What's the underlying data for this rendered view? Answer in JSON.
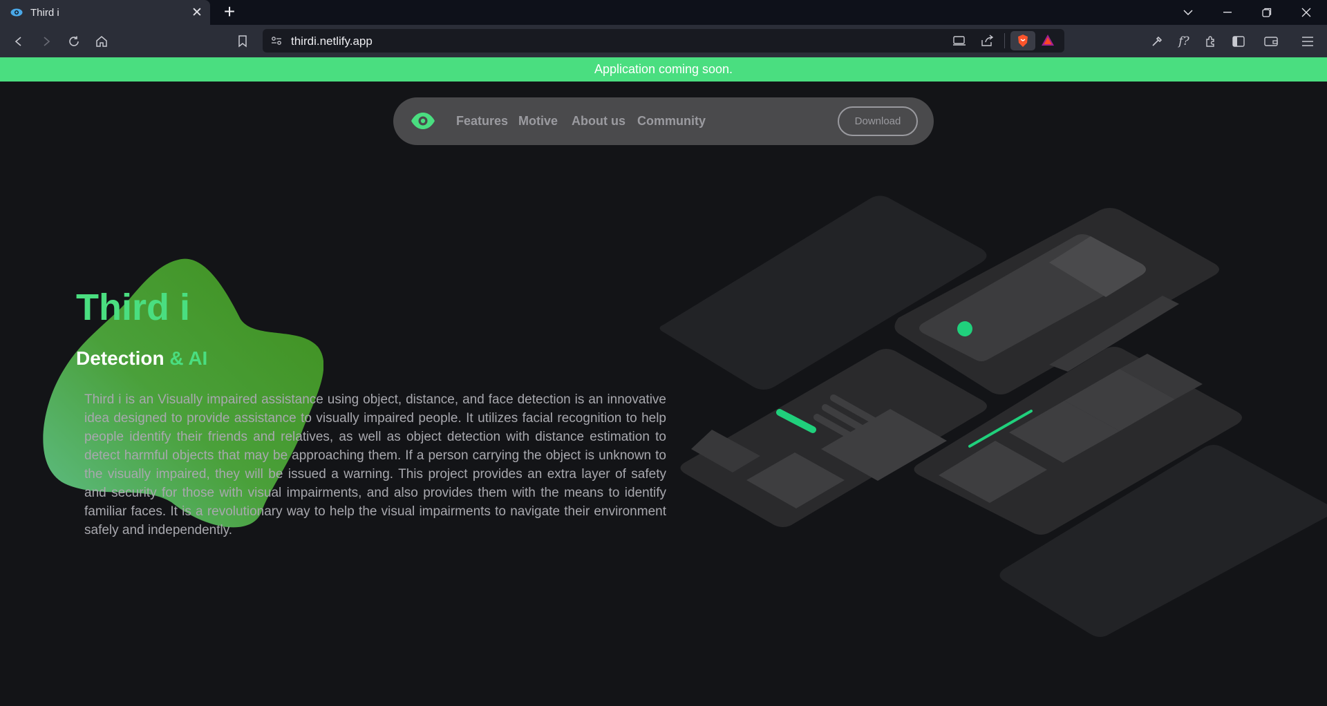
{
  "browser": {
    "tab_title": "Third i",
    "url": "thirdi.netlify.app"
  },
  "banner": {
    "text": "Application coming soon."
  },
  "nav": {
    "links": [
      "Features",
      "Motive",
      "About us",
      "Community"
    ],
    "download_label": "Download"
  },
  "hero": {
    "title": "Third i",
    "subtitle_main": "Detection",
    "subtitle_accent": " & AI",
    "description": "Third i is an Visually impaired assistance using object, distance, and face detection is an innovative idea designed to provide assistance to visually impaired people. It utilizes facial recognition to help people identify their friends and relatives, as well as object detection with distance estimation to detect harmful objects that may be approaching them. If a person carrying the object is unknown to the visually impaired, they will be issued a warning. This project provides an extra layer of safety and security for those with visual impairments, and also provides them with the means to identify familiar faces. It is a revolutionary way to help the visual impairments to navigate their environment safely and independently."
  },
  "colors": {
    "accent": "#4ade80",
    "background": "#131417",
    "nav_bg": "#4a4a4c",
    "blob_green": "#4a9a2a"
  },
  "icons": {
    "brand": "eye-icon",
    "tab_favicon": "eye-icon"
  }
}
